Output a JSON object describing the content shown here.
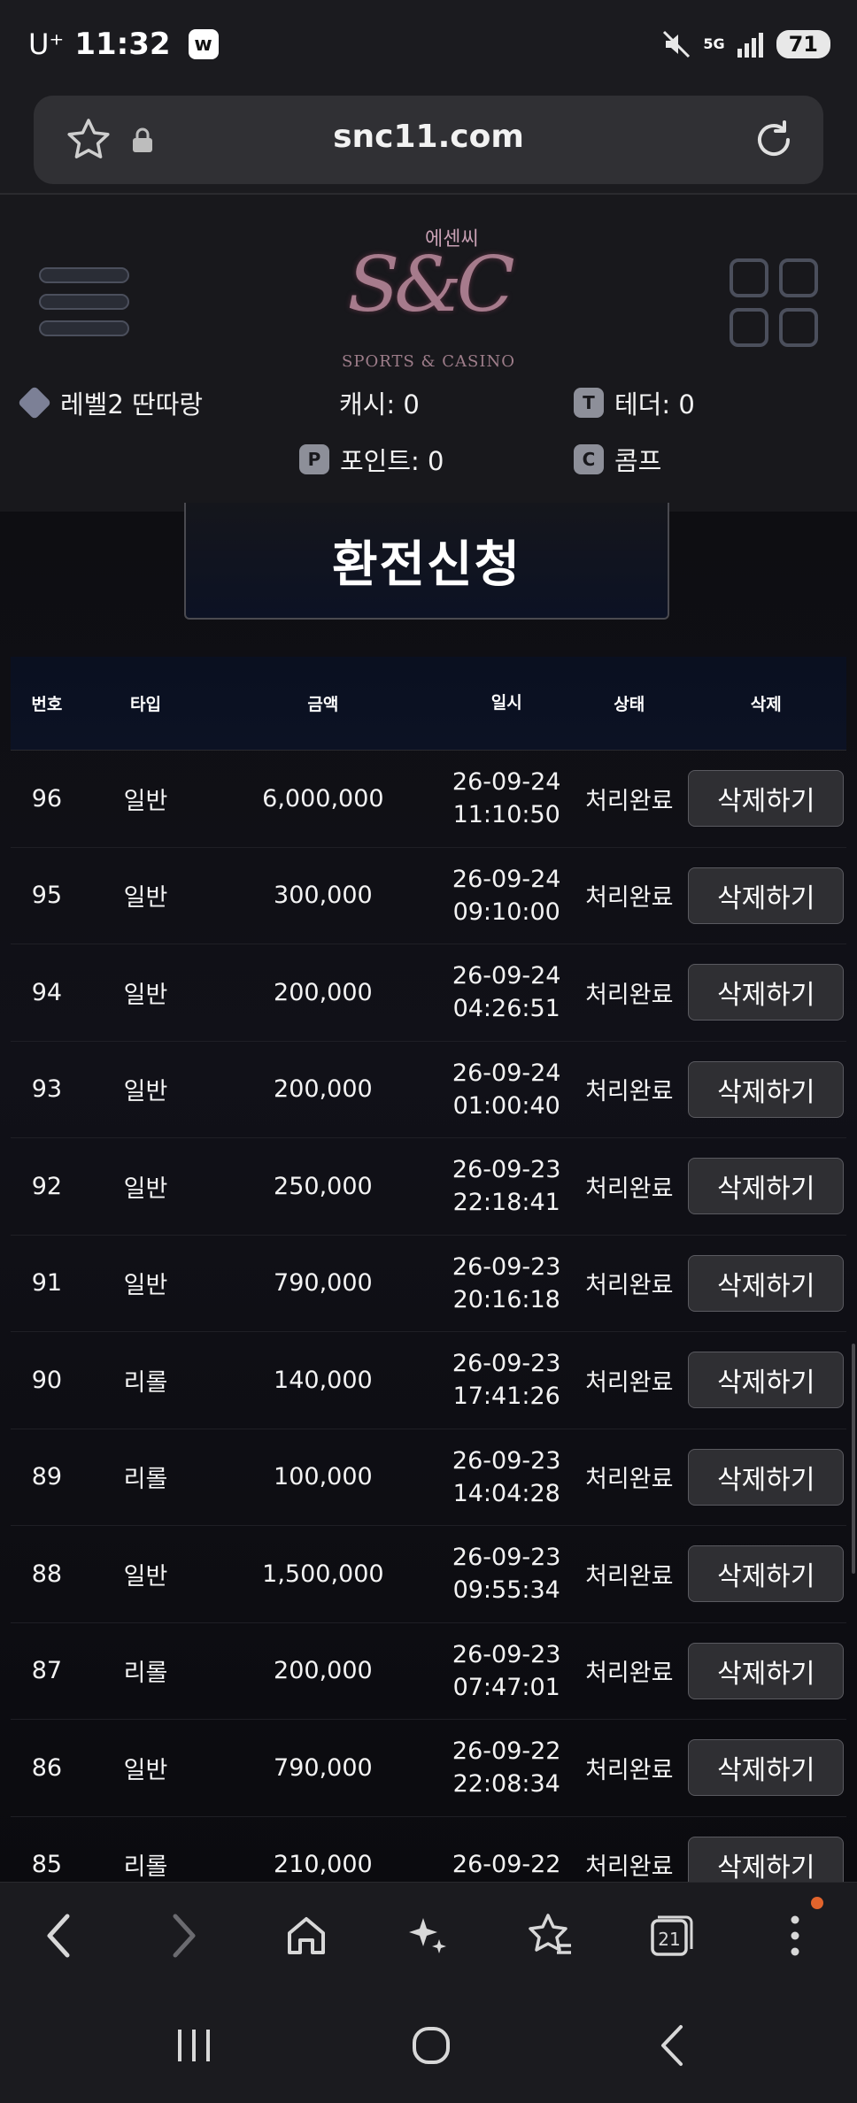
{
  "status_bar": {
    "carrier": "U⁺",
    "time": "11:32",
    "app_badge": "w",
    "network": "5G",
    "battery": "71"
  },
  "browser": {
    "url": "snc11.com"
  },
  "site": {
    "logo_korean": "에센씨",
    "logo_main": "S&C",
    "logo_sub": "SPORTS & CASINO",
    "level": "레벨2 딴따랑",
    "cash": "캐시: 0",
    "tether": "테더: 0",
    "points": "포인트: 0",
    "comp": "콤프",
    "icon_p": "P",
    "icon_t": "T",
    "icon_c": "C"
  },
  "page_title": "환전신청",
  "table": {
    "headers": [
      "번호",
      "타입",
      "금액",
      "일시",
      "상태",
      "삭제"
    ],
    "rows": [
      {
        "no": "96",
        "type": "일반",
        "amount": "6,000,000",
        "date": "26-09-24",
        "time": "11:10:50",
        "status": "처리완료",
        "action": "삭제하기"
      },
      {
        "no": "95",
        "type": "일반",
        "amount": "300,000",
        "date": "26-09-24",
        "time": "09:10:00",
        "status": "처리완료",
        "action": "삭제하기"
      },
      {
        "no": "94",
        "type": "일반",
        "amount": "200,000",
        "date": "26-09-24",
        "time": "04:26:51",
        "status": "처리완료",
        "action": "삭제하기"
      },
      {
        "no": "93",
        "type": "일반",
        "amount": "200,000",
        "date": "26-09-24",
        "time": "01:00:40",
        "status": "처리완료",
        "action": "삭제하기"
      },
      {
        "no": "92",
        "type": "일반",
        "amount": "250,000",
        "date": "26-09-23",
        "time": "22:18:41",
        "status": "처리완료",
        "action": "삭제하기"
      },
      {
        "no": "91",
        "type": "일반",
        "amount": "790,000",
        "date": "26-09-23",
        "time": "20:16:18",
        "status": "처리완료",
        "action": "삭제하기"
      },
      {
        "no": "90",
        "type": "리롤",
        "amount": "140,000",
        "date": "26-09-23",
        "time": "17:41:26",
        "status": "처리완료",
        "action": "삭제하기"
      },
      {
        "no": "89",
        "type": "리롤",
        "amount": "100,000",
        "date": "26-09-23",
        "time": "14:04:28",
        "status": "처리완료",
        "action": "삭제하기"
      },
      {
        "no": "88",
        "type": "일반",
        "amount": "1,500,000",
        "date": "26-09-23",
        "time": "09:55:34",
        "status": "처리완료",
        "action": "삭제하기"
      },
      {
        "no": "87",
        "type": "리롤",
        "amount": "200,000",
        "date": "26-09-23",
        "time": "07:47:01",
        "status": "처리완료",
        "action": "삭제하기"
      },
      {
        "no": "86",
        "type": "일반",
        "amount": "790,000",
        "date": "26-09-22",
        "time": "22:08:34",
        "status": "처리완료",
        "action": "삭제하기"
      },
      {
        "no": "85",
        "type": "리롤",
        "amount": "210,000",
        "date": "26-09-22",
        "time": "",
        "status": "처리완료",
        "action": "삭제하기"
      }
    ]
  },
  "toolbar": {
    "tabs_count": "21"
  },
  "colors": {
    "accent_badge": "#e2642c",
    "button_bg": "#2f2f33",
    "page_bg": "#0e0e12"
  }
}
